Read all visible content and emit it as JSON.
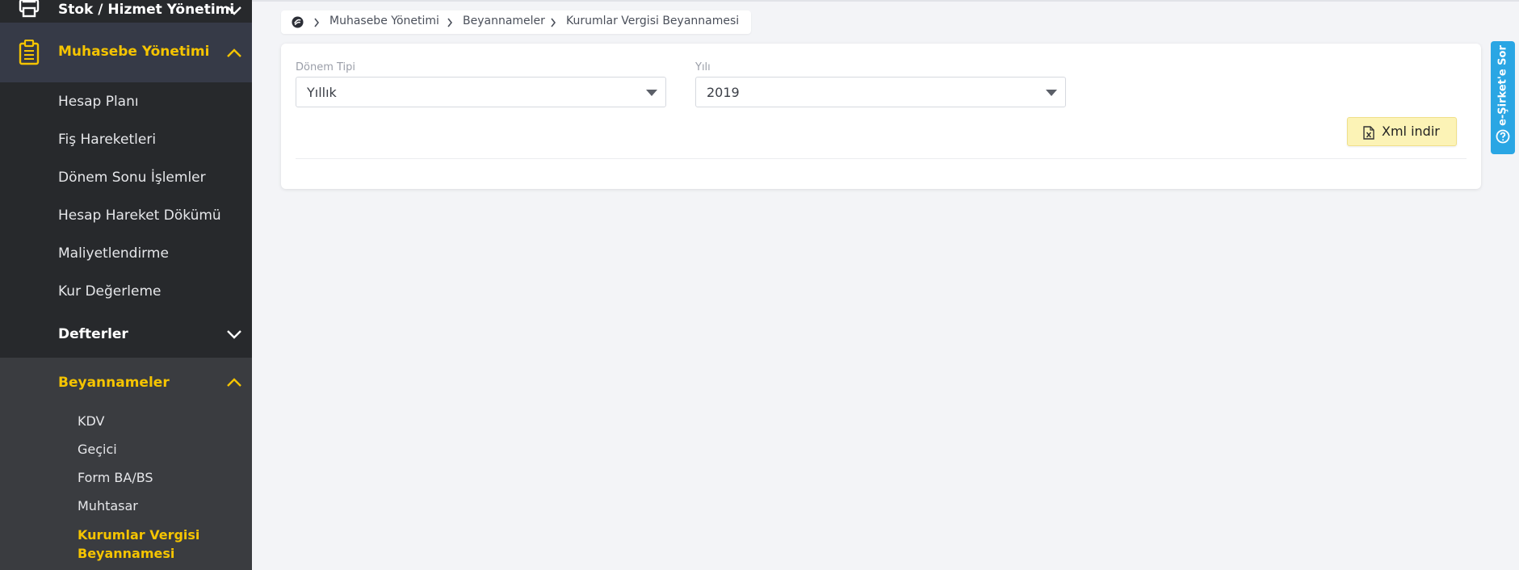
{
  "sidebar": {
    "stok_label": "Stok / Hizmet Yönetimi",
    "muhasebe_label": "Muhasebe Yönetimi",
    "muhasebe_items": [
      "Hesap Planı",
      "Fiş Hareketleri",
      "Dönem Sonu İşlemler",
      "Hesap Hareket Dökümü",
      "Maliyetlendirme",
      "Kur Değerleme"
    ],
    "defterler_label": "Defterler",
    "beyannameler_label": "Beyannameler",
    "beyannameler_items": [
      "KDV",
      "Geçici",
      "Form BA/BS",
      "Muhtasar"
    ],
    "active_item": "Kurumlar Vergisi Beyannamesi"
  },
  "breadcrumb": {
    "items": [
      "Muhasebe Yönetimi",
      "Beyannameler",
      "Kurumlar Vergisi Beyannamesi"
    ]
  },
  "form": {
    "donem_tipi": {
      "label": "Dönem Tipi",
      "value": "Yıllık"
    },
    "yili": {
      "label": "Yılı",
      "value": "2019"
    },
    "xml_button_label": "Xml indir"
  },
  "side_tab": {
    "label": "e-Şirket'e Sor"
  },
  "colors": {
    "sidebar_bg": "#27292c",
    "accent_yellow": "#f5c400",
    "button_yellow": "#fcf3b6",
    "side_tab_blue": "#2aa6e4"
  },
  "icons": {
    "stok": "printer-icon",
    "muhasebe": "clipboard-icon",
    "home": "home-logo-icon",
    "xml": "excel-file-icon",
    "help": "help-circle-icon"
  }
}
